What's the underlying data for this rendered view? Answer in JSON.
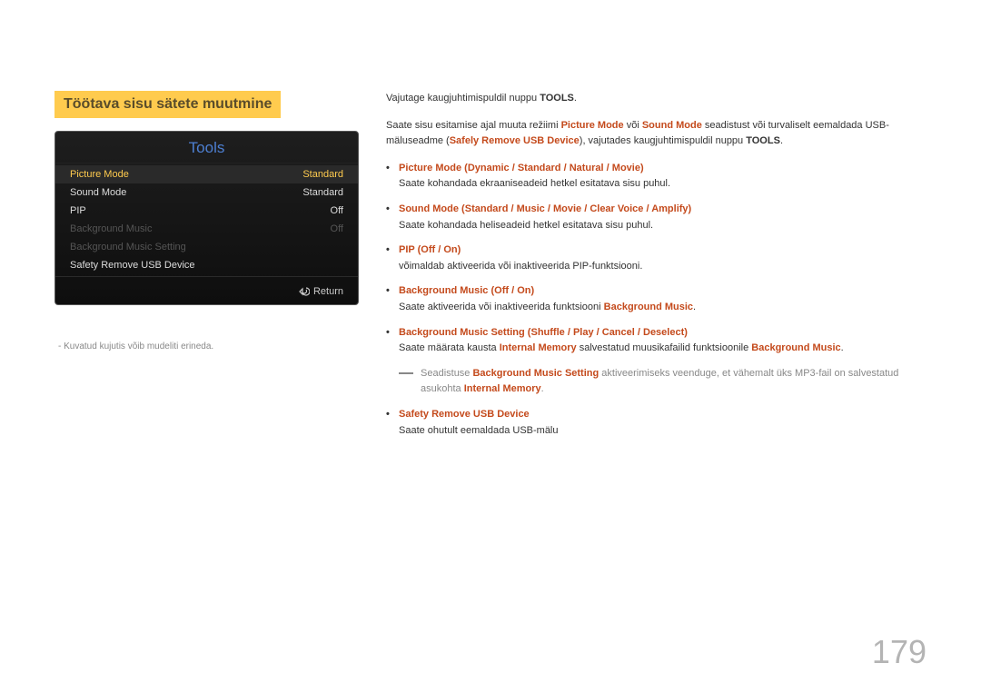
{
  "section_title": "Töötava sisu sätete muutmine",
  "tools_panel": {
    "header": "Tools",
    "rows": [
      {
        "label": "Picture Mode",
        "value": "Standard",
        "state": "selected"
      },
      {
        "label": "Sound Mode",
        "value": "Standard",
        "state": "normal"
      },
      {
        "label": "PIP",
        "value": "Off",
        "state": "normal"
      },
      {
        "label": "Background Music",
        "value": "Off",
        "state": "disabled"
      },
      {
        "label": "Background Music Setting",
        "value": "",
        "state": "disabled"
      },
      {
        "label": "Safety Remove USB Device",
        "value": "",
        "state": "normal"
      }
    ],
    "footer_label": "Return"
  },
  "footnote": "Kuvatud kujutis võib mudeliti erineda.",
  "intro": {
    "line1_prefix": "Vajutage kaugjuhtimispuldil nuppu ",
    "line1_bold": "TOOLS",
    "line1_suffix": ".",
    "line2_prefix": "Saate sisu esitamise ajal muuta režiimi ",
    "line2_hl1": "Picture Mode",
    "line2_mid1": " või ",
    "line2_hl2": "Sound Mode",
    "line2_mid2": " seadistust või turvaliselt eemaldada USB-mäluseadme (",
    "line2_hl3": "Safely Remove USB Device",
    "line2_mid3": "), vajutades kaugjuhtimispuldil nuppu ",
    "line2_bold": "TOOLS",
    "line2_suffix": "."
  },
  "bullets": [
    {
      "title_parts": [
        "Picture Mode",
        " (",
        "Dynamic",
        " / ",
        "Standard",
        " / ",
        "Natural",
        " / ",
        "Movie",
        ")"
      ],
      "desc": "Saate kohandada ekraaniseadeid hetkel esitatava sisu puhul."
    },
    {
      "title_parts": [
        "Sound Mode",
        " (",
        "Standard",
        " / ",
        "Music",
        " / ",
        "Movie",
        " / ",
        "Clear Voice",
        " / ",
        "Amplify",
        ")"
      ],
      "desc": "Saate kohandada heliseadeid hetkel esitatava sisu puhul."
    },
    {
      "title_parts": [
        "PIP",
        " (",
        "Off",
        " / ",
        "On",
        ")"
      ],
      "desc": "võimaldab aktiveerida või inaktiveerida PIP-funktsiooni."
    },
    {
      "title_parts": [
        "Background Music",
        " (",
        "Off",
        " / ",
        "On",
        ")"
      ],
      "desc_prefix": "Saate aktiveerida või inaktiveerida funktsiooni ",
      "desc_hl": "Background Music",
      "desc_suffix": "."
    },
    {
      "title_parts": [
        "Background Music Setting",
        " (",
        "Shuffle",
        " / ",
        "Play",
        " / ",
        "Cancel",
        " / ",
        "Deselect",
        ")"
      ],
      "desc_prefix": "Saate määrata kausta ",
      "desc_hl1": "Internal Memory",
      "desc_mid": " salvestatud muusikafailid funktsioonile ",
      "desc_hl2": "Background Music",
      "desc_suffix": "."
    }
  ],
  "note": {
    "prefix": "Seadistuse ",
    "hl1": "Background Music Setting",
    "mid": " aktiveerimiseks veenduge, et vähemalt üks MP3-fail on salvestatud asukohta ",
    "hl2": "Internal Memory",
    "suffix": "."
  },
  "last_bullet": {
    "title": "Safety Remove USB Device",
    "desc": "Saate ohutult eemaldada USB-mälu"
  },
  "page_number": "179"
}
